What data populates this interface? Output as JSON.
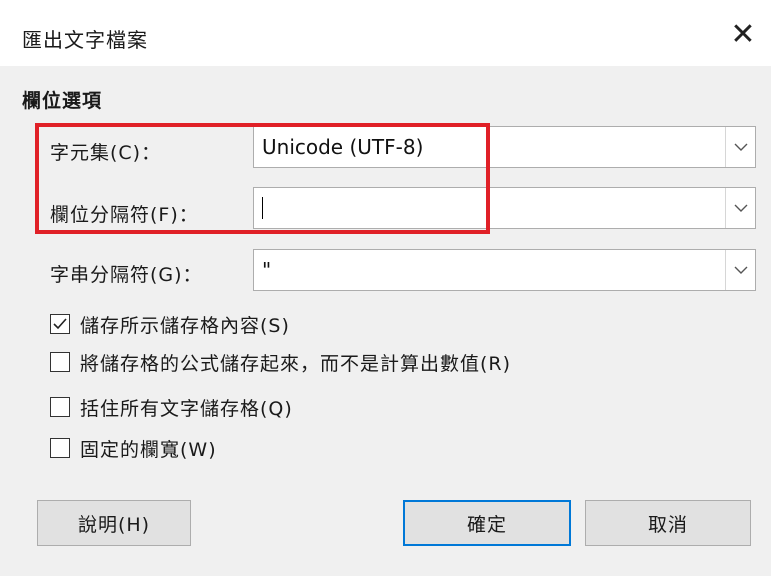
{
  "window": {
    "title": "匯出文字檔案",
    "close_glyph": "✕"
  },
  "section": {
    "title": "欄位選項"
  },
  "fields": {
    "charset": {
      "label": "字元集(C)：",
      "value": "Unicode (UTF-8)"
    },
    "field_delimiter": {
      "label": "欄位分隔符(F)：",
      "value": ""
    },
    "string_delimiter": {
      "label": "字串分隔符(G)：",
      "value": "\""
    }
  },
  "options": [
    {
      "label": "儲存所示儲存格內容(S)",
      "checked": true
    },
    {
      "label": "將儲存格的公式儲存起來，而不是計算出數值(R)",
      "checked": false
    },
    {
      "label": "括住所有文字儲存格(Q)",
      "checked": false
    },
    {
      "label": "固定的欄寬(W)",
      "checked": false
    }
  ],
  "buttons": {
    "help": "說明(H)",
    "ok": "確定",
    "cancel": "取消"
  },
  "colors": {
    "highlight": "#e02027",
    "default_button_border": "#0078d7"
  }
}
